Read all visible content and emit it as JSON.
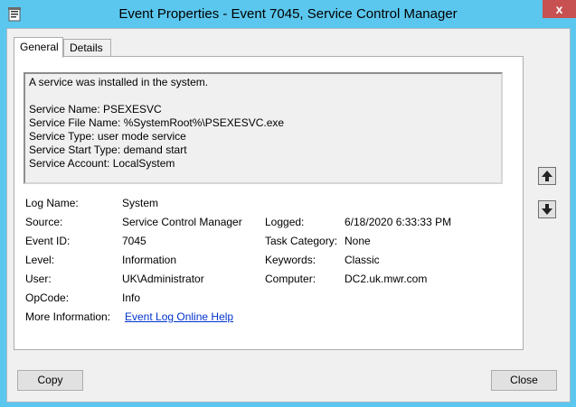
{
  "window": {
    "title": "Event Properties - Event 7045, Service Control Manager",
    "close_glyph": "x"
  },
  "tabs": [
    {
      "label": "General",
      "active": true
    },
    {
      "label": "Details",
      "active": false
    }
  ],
  "description": {
    "lines": [
      "A service was installed in the system.",
      "",
      "Service Name:  PSEXESVC",
      "Service File Name:  %SystemRoot%\\PSEXESVC.exe",
      "Service Type:  user mode service",
      "Service Start Type:  demand start",
      "Service Account:  LocalSystem"
    ]
  },
  "fields": {
    "log_name": {
      "label": "Log Name:",
      "value": "System"
    },
    "source": {
      "label": "Source:",
      "value": "Service Control Manager"
    },
    "logged": {
      "label": "Logged:",
      "value": "6/18/2020 6:33:33 PM"
    },
    "event_id": {
      "label": "Event ID:",
      "value": "7045"
    },
    "task_category": {
      "label": "Task Category:",
      "value": "None"
    },
    "level": {
      "label": "Level:",
      "value": "Information"
    },
    "keywords": {
      "label": "Keywords:",
      "value": "Classic"
    },
    "user": {
      "label": "User:",
      "value": "UK\\Administrator"
    },
    "computer": {
      "label": "Computer:",
      "value": "DC2.uk.mwr.com"
    },
    "opcode": {
      "label": "OpCode:",
      "value": "Info"
    },
    "more_info": {
      "label": "More Information:",
      "value": "Event Log Online Help"
    }
  },
  "buttons": {
    "copy": "Copy",
    "close": "Close"
  },
  "icons": {
    "app": "event-log-icon",
    "scroll_up": "arrow-up-icon",
    "scroll_down": "arrow-down-icon"
  },
  "colors": {
    "titlebar": "#5bc7ee",
    "close_button": "#c75050",
    "link": "#0033cc"
  }
}
